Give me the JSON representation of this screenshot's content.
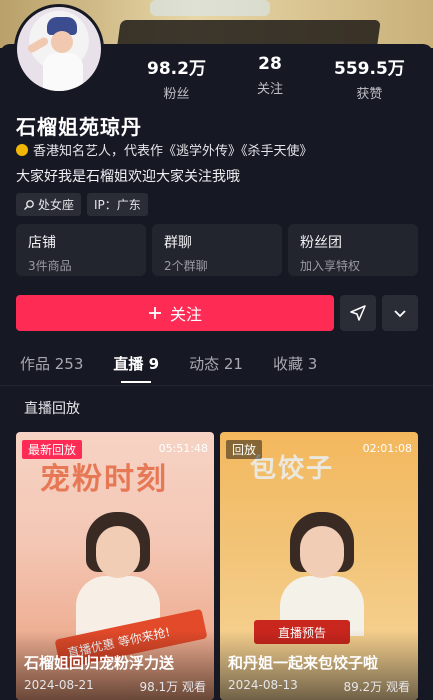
{
  "profile": {
    "name": "石榴姐苑琼丹",
    "verify_text": "香港知名艺人，代表作《逃学外传》《杀手天使》",
    "bio": "大家好我是石榴姐欢迎大家关注我哦",
    "tags": [
      "处女座",
      "IP：广东"
    ]
  },
  "stats": [
    {
      "num": "98.2万",
      "label": "粉丝"
    },
    {
      "num": "28",
      "label": "关注"
    },
    {
      "num": "559.5万",
      "label": "获赞"
    }
  ],
  "cards": [
    {
      "title": "店铺",
      "sub": "3件商品"
    },
    {
      "title": "群聊",
      "sub": "2个群聊"
    },
    {
      "title": "粉丝团",
      "sub": "加入享特权"
    }
  ],
  "actions": {
    "follow_label": "关注"
  },
  "tabs": [
    {
      "label": "作品 253"
    },
    {
      "label": "直播 9"
    },
    {
      "label": "动态 21"
    },
    {
      "label": "收藏 3"
    }
  ],
  "section_title": "直播回放",
  "videos": [
    {
      "badge": "最新回放",
      "duration": "05:51:48",
      "headline": "宠粉时刻",
      "promo": "直播优惠 等你来抢!",
      "title": "石榴姐回归宠粉浮力送",
      "date": "2024-08-21",
      "views": "98.1万 观看"
    },
    {
      "badge": "回放",
      "duration": "02:01:08",
      "headline": "包饺子",
      "promo": "直播预告",
      "title": "和丹姐一起来包饺子啦",
      "date": "2024-08-13",
      "views": "89.2万 观看"
    }
  ],
  "colors": {
    "accent": "#fe2c55",
    "bg": "#161823",
    "card": "#22242e"
  }
}
